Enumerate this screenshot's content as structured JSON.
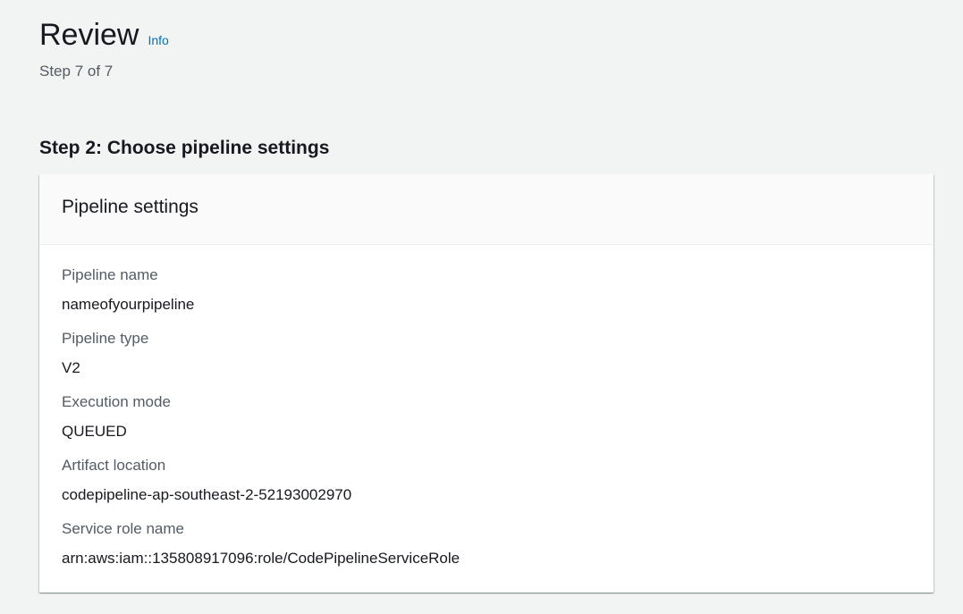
{
  "header": {
    "title": "Review",
    "info_link": "Info",
    "step_label": "Step 7 of 7"
  },
  "section": {
    "heading": "Step 2: Choose pipeline settings"
  },
  "panel": {
    "title": "Pipeline settings",
    "fields": [
      {
        "label": "Pipeline name",
        "value": "nameofyourpipeline"
      },
      {
        "label": "Pipeline type",
        "value": "V2"
      },
      {
        "label": "Execution mode",
        "value": "QUEUED"
      },
      {
        "label": "Artifact location",
        "value": "codepipeline-ap-southeast-2-52193002970"
      },
      {
        "label": "Service role name",
        "value": "arn:aws:iam::135808917096:role/CodePipelineServiceRole"
      }
    ]
  },
  "colors": {
    "background": "#f2f3f3",
    "link": "#0073bb",
    "text_primary": "#16191f",
    "text_secondary": "#545b64"
  }
}
